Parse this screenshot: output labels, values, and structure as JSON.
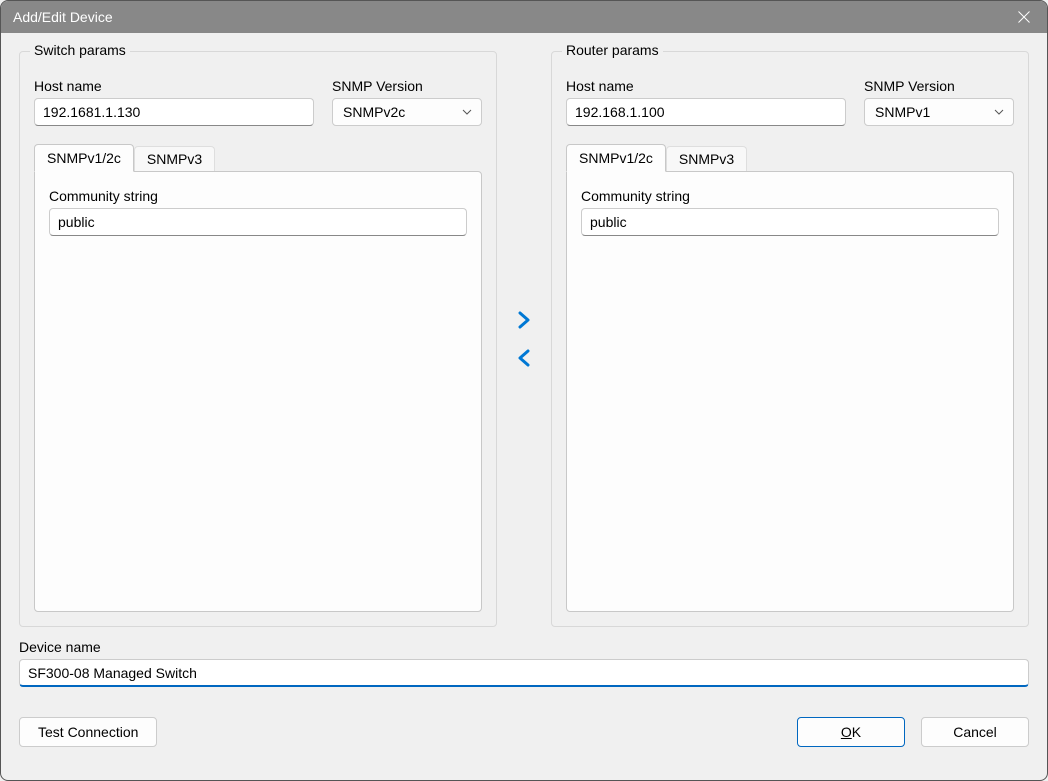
{
  "titlebar": {
    "title": "Add/Edit Device"
  },
  "switch": {
    "legend": "Switch params",
    "host_label": "Host name",
    "host_value": "192.1681.1.130",
    "snmp_version_label": "SNMP Version",
    "snmp_version_value": "SNMPv2c",
    "tabs": {
      "v12c": "SNMPv1/2c",
      "v3": "SNMPv3"
    },
    "community_label": "Community string",
    "community_value": "public"
  },
  "router": {
    "legend": "Router params",
    "host_label": "Host name",
    "host_value": "192.168.1.100",
    "snmp_version_label": "SNMP Version",
    "snmp_version_value": "SNMPv1",
    "tabs": {
      "v12c": "SNMPv1/2c",
      "v3": "SNMPv3"
    },
    "community_label": "Community string",
    "community_value": "public"
  },
  "device_name": {
    "label": "Device name",
    "value": "SF300-08 Managed Switch"
  },
  "buttons": {
    "test": "Test Connection",
    "ok": "OK",
    "cancel": "Cancel"
  }
}
